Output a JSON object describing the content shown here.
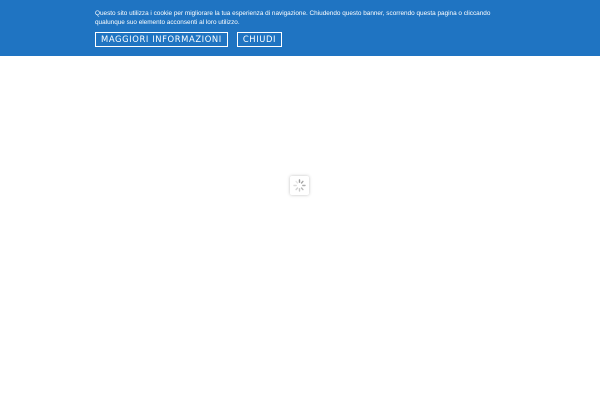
{
  "colors": {
    "banner_background": "#1f74c2",
    "banner_text": "#ffffff",
    "page_background": "#ffffff",
    "spinner": "#9a9a9a"
  },
  "cookie_banner": {
    "message": "Questo sito utilizza i cookie per migliorare la tua esperienza di navigazione. Chiudendo questo banner, scorrendo questa pagina o cliccando qualunque suo elemento acconsenti al loro utilizzo.",
    "more_info_label": "MAGGIORI INFORMAZIONI",
    "close_label": "CHIUDI"
  },
  "loader": {
    "icon": "spinner-icon"
  }
}
